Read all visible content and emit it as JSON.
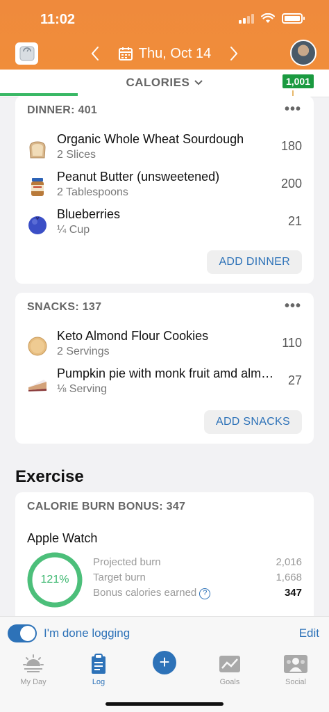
{
  "status": {
    "time": "11:02"
  },
  "header": {
    "date": "Thu, Oct 14"
  },
  "calories": {
    "title": "CALORIES",
    "badge": "1,001"
  },
  "dinner": {
    "title": "DINNER: 401",
    "items": [
      {
        "name": "Organic Whole Wheat Sourdough",
        "serving": "2 Slices",
        "cal": "180",
        "icon": "bread-icon"
      },
      {
        "name": "Peanut Butter (unsweetened)",
        "serving": "2 Tablespoons",
        "cal": "200",
        "icon": "peanut-butter-icon"
      },
      {
        "name": "Blueberries",
        "serving": "¼ Cup",
        "cal": "21",
        "icon": "blueberry-icon"
      }
    ],
    "add_label": "ADD DINNER"
  },
  "snacks": {
    "title": "SNACKS: 137",
    "items": [
      {
        "name": "Keto Almond Flour Cookies",
        "serving": "2 Servings",
        "cal": "110",
        "icon": "cookie-icon"
      },
      {
        "name": "Pumpkin pie with monk fruit amd alm…",
        "serving": "⅛ Serving",
        "cal": "27",
        "icon": "pie-icon"
      }
    ],
    "add_label": "ADD SNACKS"
  },
  "exercise": {
    "title": "Exercise",
    "card_title": "CALORIE BURN BONUS: 347",
    "source": "Apple Watch",
    "ring_label": "121%",
    "stats": [
      {
        "label": "Projected burn",
        "value": "2,016"
      },
      {
        "label": "Target burn",
        "value": "1,668"
      },
      {
        "label": "Bonus calories earned",
        "value": "347"
      }
    ]
  },
  "logbar": {
    "done_label": "I'm done logging",
    "edit_label": "Edit"
  },
  "tabs": {
    "myday": "My Day",
    "log": "Log",
    "goals": "Goals",
    "social": "Social"
  },
  "colors": {
    "header": "#ef8a3c",
    "accent": "#2d72b8",
    "success": "#1a9a40"
  }
}
